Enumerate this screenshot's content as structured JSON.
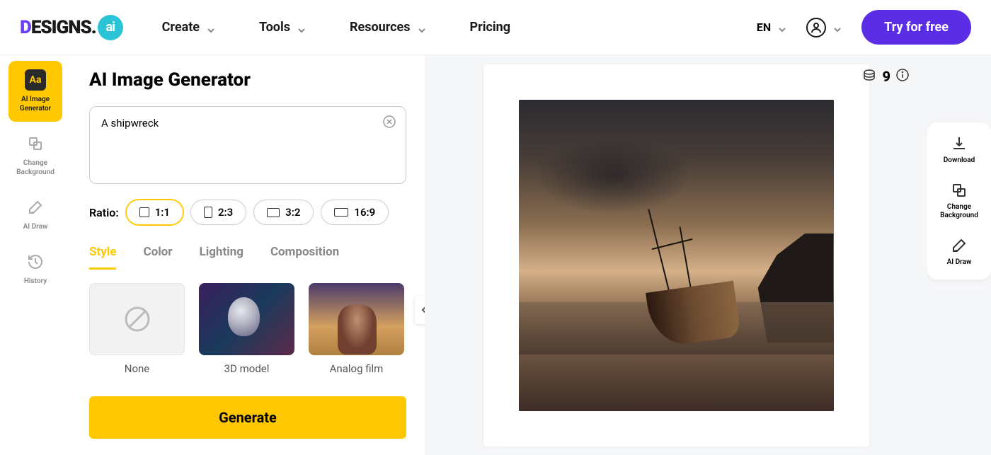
{
  "header": {
    "logo_part1": "D",
    "logo_part2": "ESIGNS.",
    "logo_badge": "ai",
    "nav": [
      "Create",
      "Tools",
      "Resources",
      "Pricing"
    ],
    "language": "EN",
    "cta": "Try for free"
  },
  "sidebar": {
    "items": [
      {
        "label": "AI Image Generator",
        "icon": "text-aa"
      },
      {
        "label": "Change Background",
        "icon": "layers"
      },
      {
        "label": "AI Draw",
        "icon": "pencil"
      },
      {
        "label": "History",
        "icon": "history"
      }
    ]
  },
  "panel": {
    "title": "AI Image Generator",
    "prompt": "A shipwreck",
    "ratio_label": "Ratio:",
    "ratios": [
      "1:1",
      "2:3",
      "3:2",
      "16:9"
    ],
    "tabs": [
      "Style",
      "Color",
      "Lighting",
      "Composition"
    ],
    "styles": [
      {
        "label": "None"
      },
      {
        "label": "3D model"
      },
      {
        "label": "Analog film"
      }
    ],
    "generate": "Generate"
  },
  "credits": {
    "count": "9"
  },
  "actions": {
    "items": [
      {
        "label": "Download",
        "icon": "download"
      },
      {
        "label": "Change Background",
        "icon": "layers"
      },
      {
        "label": "AI Draw",
        "icon": "pencil"
      }
    ]
  }
}
